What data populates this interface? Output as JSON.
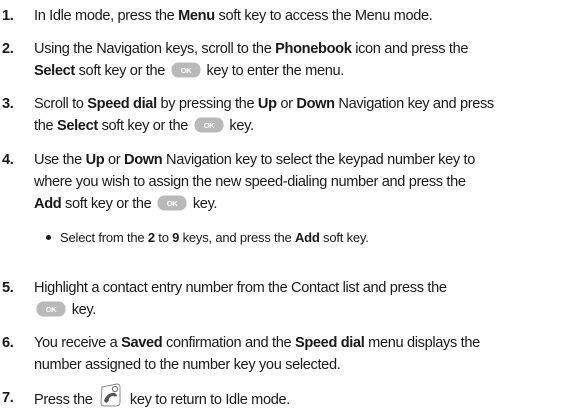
{
  "steps": [
    {
      "num": "1.",
      "lines": [
        [
          {
            "t": "In Idle mode, press the "
          },
          {
            "b": "Menu"
          },
          {
            "t": " soft key to access the Menu mode."
          }
        ]
      ]
    },
    {
      "num": "2.",
      "lines": [
        [
          {
            "t": "Using the Navigation keys, scroll to the "
          },
          {
            "b": "Phonebook"
          },
          {
            "t": " icon and press the"
          }
        ],
        [
          {
            "b": "Select"
          },
          {
            "t": " soft key or the "
          },
          {
            "icon": "ok-key-icon"
          },
          {
            "t": " key to enter the menu."
          }
        ]
      ]
    },
    {
      "num": "3.",
      "lines": [
        [
          {
            "t": "Scroll to "
          },
          {
            "b": "Speed dial"
          },
          {
            "t": " by pressing the "
          },
          {
            "b": "Up"
          },
          {
            "t": " or "
          },
          {
            "b": "Down"
          },
          {
            "t": " Navigation key and press"
          }
        ],
        [
          {
            "t": "the "
          },
          {
            "b": "Select"
          },
          {
            "t": " soft key or the "
          },
          {
            "icon": "ok-key-icon"
          },
          {
            "t": " key."
          }
        ]
      ]
    },
    {
      "num": "4.",
      "lines": [
        [
          {
            "t": "Use the "
          },
          {
            "b": "Up"
          },
          {
            "t": " or "
          },
          {
            "b": "Down"
          },
          {
            "t": " Navigation key to select the keypad number key to"
          }
        ],
        [
          {
            "t": "where you wish to assign the new speed-dialing number and press the"
          }
        ],
        [
          {
            "b": "Add"
          },
          {
            "t": " soft key or the "
          },
          {
            "icon": "ok-key-icon"
          },
          {
            "t": " key."
          }
        ]
      ],
      "bullet": [
        {
          "t": "Select from the "
        },
        {
          "b": "2"
        },
        {
          "t": " to "
        },
        {
          "b": "9"
        },
        {
          "t": " keys, and press the "
        },
        {
          "b": "Add"
        },
        {
          "t": " soft key."
        }
      ]
    },
    {
      "num": "5.",
      "lines": [
        [
          {
            "t": "Highlight a contact entry number from the Contact list and press the"
          }
        ],
        [
          {
            "icon": "ok-key-icon"
          },
          {
            "t": " key."
          }
        ]
      ]
    },
    {
      "num": "6.",
      "lines": [
        [
          {
            "t": "You receive a "
          },
          {
            "b": "Saved"
          },
          {
            "t": " confirmation and the "
          },
          {
            "b": "Speed dial"
          },
          {
            "t": " menu displays the"
          }
        ],
        [
          {
            "t": "number assigned to the number key you selected."
          }
        ]
      ]
    },
    {
      "num": "7.",
      "lines": [
        [
          {
            "t": "Press the "
          },
          {
            "icon": "end-key-icon"
          },
          {
            "t": " key to return to Idle mode."
          }
        ]
      ]
    }
  ],
  "icons": {
    "ok_label": "OK",
    "ok_fill": "#b9b9b9",
    "ok_text": "#ffffff"
  }
}
